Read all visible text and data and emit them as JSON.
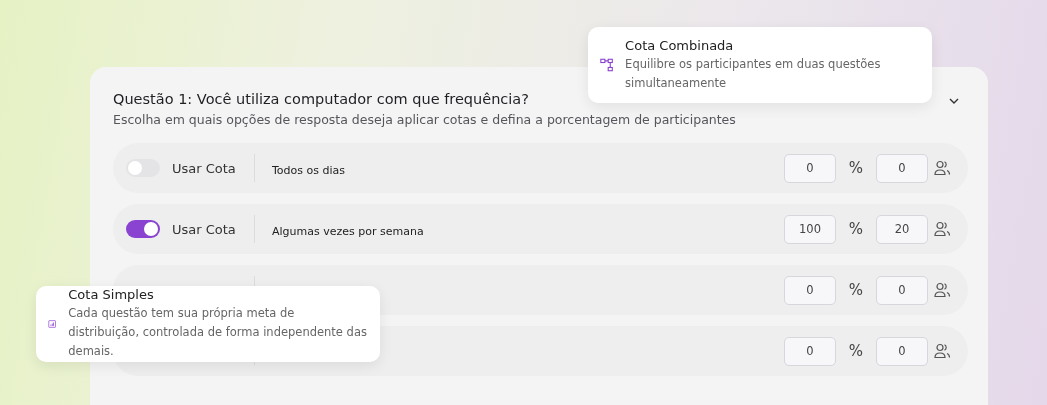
{
  "question": {
    "title": "Questão 1: Você utiliza computador com que frequência?",
    "subtitle": "Escolha em quais opções de resposta deseja aplicar cotas e defina a porcentagem de participantes",
    "expanded": true
  },
  "rows": [
    {
      "toggle_label": "Usar Cota",
      "on": false,
      "answer": "Todos os dias",
      "percent": "0",
      "percent_unit": "%",
      "participants": "0"
    },
    {
      "toggle_label": "Usar Cota",
      "on": true,
      "answer": "Algumas vezes por semana",
      "percent": "100",
      "percent_unit": "%",
      "participants": "20"
    },
    {
      "percent": "0",
      "percent_unit": "%",
      "participants": "0"
    },
    {
      "percent": "0",
      "percent_unit": "%",
      "participants": "0"
    }
  ],
  "popovers": [
    {
      "kind": "combined",
      "title": "Cota Combinada",
      "description": "Equilibre os participantes em duas questões simultaneamente"
    },
    {
      "kind": "simple",
      "title": "Cota Simples",
      "description": "Cada questão tem sua própria meta de distribuição, controlada de forma independente das demais."
    }
  ]
}
